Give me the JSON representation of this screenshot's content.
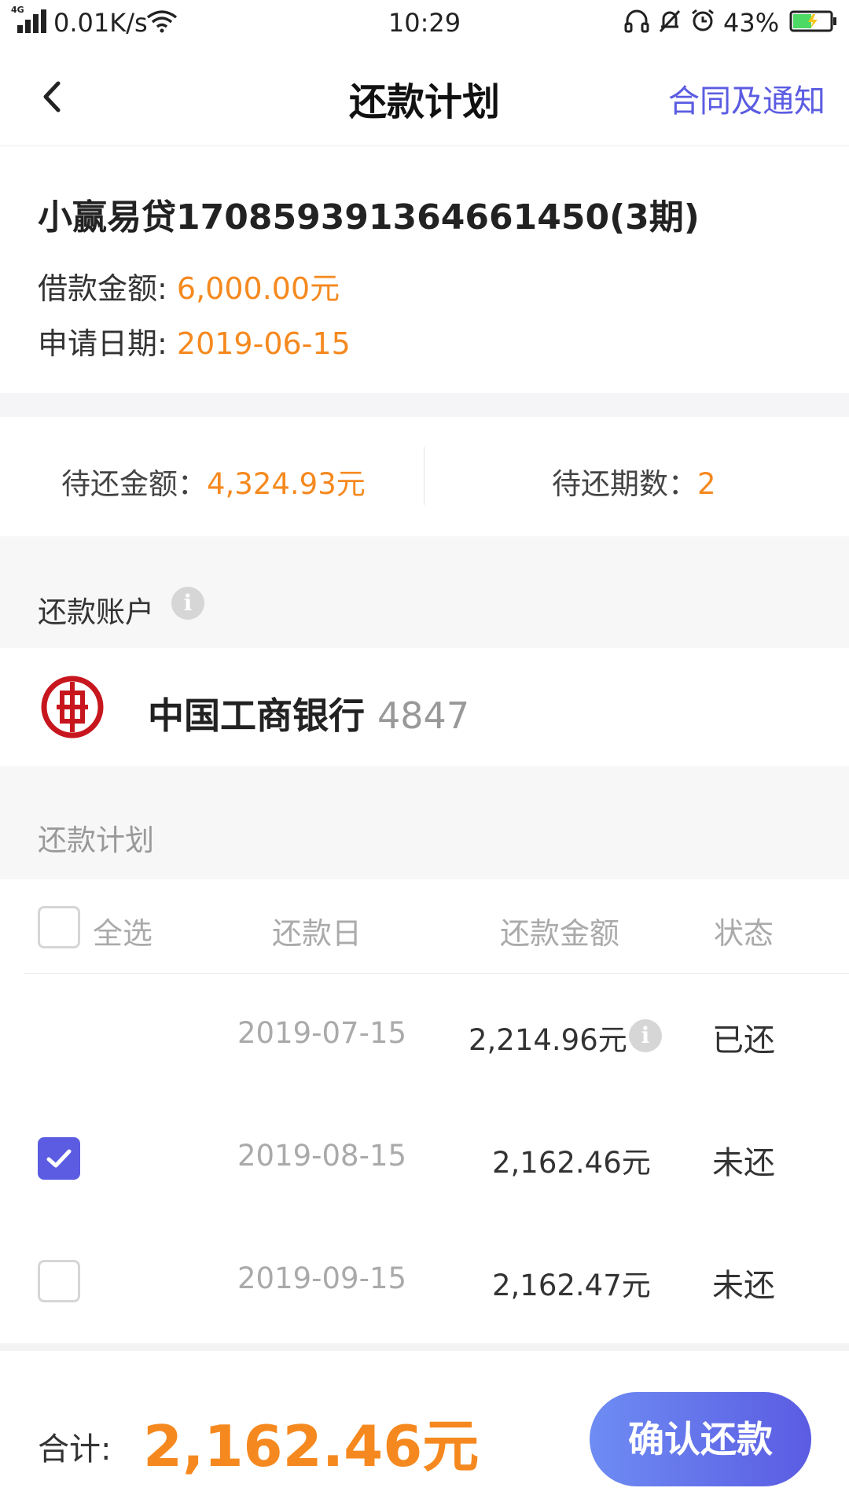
{
  "status_bar": {
    "network": "4G",
    "speed": "0.01K/s",
    "time": "10:29",
    "battery": "43%"
  },
  "header": {
    "title": "还款计划",
    "right_link": "合同及通知"
  },
  "loan": {
    "title": "小赢易贷17085939136466145​0(3期)",
    "amount_label": "借款金额:",
    "amount_value": "6,000.00元",
    "date_label": "申请日期:",
    "date_value": "2019-06-15"
  },
  "summary": {
    "pending_amount_label": "待还金额：",
    "pending_amount_value": "4,324.93元",
    "pending_terms_label": "待还期数：",
    "pending_terms_value": "2"
  },
  "account": {
    "section_label": "还款账户",
    "bank_name": "中国工商银行",
    "card_tail": "4847"
  },
  "plan": {
    "section_label": "还款计划",
    "select_all": "全选",
    "col_date": "还款日",
    "col_amount": "还款金额",
    "col_status": "状态",
    "rows": [
      {
        "date": "2019-07-15",
        "amount": "2,214.96元",
        "status": "已还",
        "checked": null
      },
      {
        "date": "2019-08-15",
        "amount": "2,162.46元",
        "status": "未还",
        "checked": true
      },
      {
        "date": "2019-09-15",
        "amount": "2,162.47元",
        "status": "未还",
        "checked": false
      }
    ]
  },
  "footer": {
    "total_label": "合计:",
    "total_value": "2,162.46元",
    "confirm_label": "确认还款"
  },
  "colors": {
    "accent": "#5b5ce2",
    "orange": "#f5891f",
    "bank_red": "#c7161e"
  }
}
